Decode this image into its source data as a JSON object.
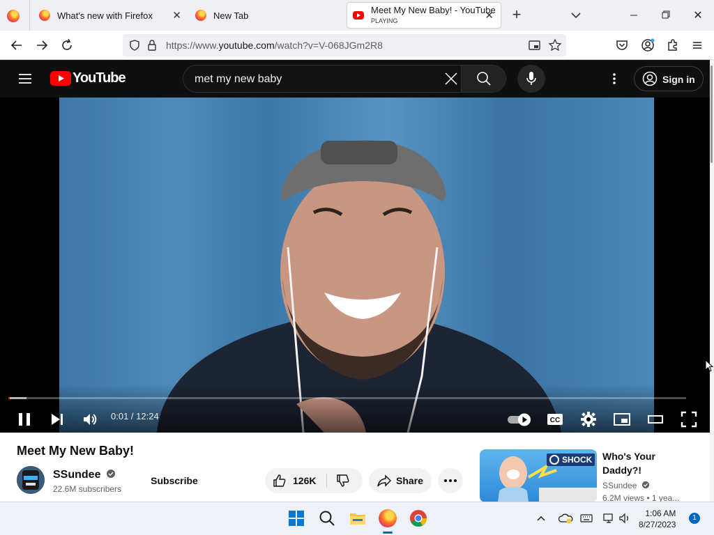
{
  "browser": {
    "tabs": [
      {
        "title": "What's new with Firefox",
        "active": false
      },
      {
        "title": "New Tab",
        "active": false
      },
      {
        "title": "Meet My New Baby! - YouTube",
        "subtitle": "PLAYING",
        "active": true
      }
    ],
    "url_prefix": "https://www.",
    "url_domain": "youtube.com",
    "url_path": "/watch?v=V-068JGm2R8"
  },
  "youtube": {
    "logo": "YouTube",
    "search_query": "met my new baby",
    "signin_label": "Sign in"
  },
  "player": {
    "time_current": "0:01",
    "time_total": "12:24",
    "time_display": "0:01 / 12:24",
    "progress_fraction": 0.0013,
    "buffered_fraction": 0.027,
    "autoplay": true
  },
  "video": {
    "title": "Meet My New Baby!",
    "channel": "SSundee",
    "verified": true,
    "subscribers": "22.6M subscribers",
    "subscribe_label": "Subscribe",
    "likes": "126K",
    "share_label": "Share"
  },
  "recommendation": {
    "title": "Who's Your Daddy?!",
    "channel": "SSundee",
    "meta": "6.2M views  •  1 yea...",
    "thumb_badge": "SHOCK"
  },
  "taskbar": {
    "time": "1:06 AM",
    "date": "8/27/2023",
    "notification_count": "1"
  },
  "colors": {
    "youtube_red": "#ff0000",
    "yt_dark": "#0f0f0f",
    "progress": "#ff0000"
  }
}
